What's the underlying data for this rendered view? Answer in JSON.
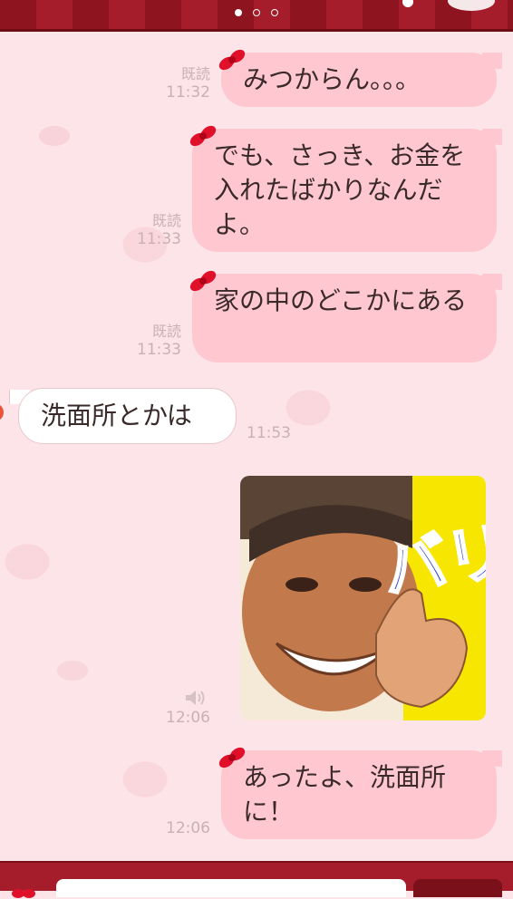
{
  "header": {
    "pages": [
      {
        "active": true
      },
      {
        "active": false
      },
      {
        "active": false
      }
    ]
  },
  "messages": [
    {
      "side": "right",
      "text": "みつからん。。。",
      "read": "既読",
      "time": "11:32"
    },
    {
      "side": "right",
      "text": "でも、さっき、お金を入れたばかりなんだよ。",
      "read": "既読",
      "time": "11:33"
    },
    {
      "side": "right",
      "text": "家の中のどこかにある",
      "read": "既読",
      "time": "11:33"
    },
    {
      "side": "left",
      "text": "洗面所とかは",
      "time": "11:53"
    },
    {
      "side": "right",
      "type": "sticker",
      "sticker_text": "バリよか!",
      "time": "12:06",
      "icon": "speaker-icon"
    },
    {
      "side": "right",
      "text": "あったよ、洗面所に！",
      "time": "12:06"
    }
  ],
  "colors": {
    "background": "#fde4e8",
    "bubble_right": "#ffc8d1",
    "bubble_left": "#ffffff",
    "bar": "#a51d2b",
    "meta_text": "#c8b0b4"
  },
  "footer": {
    "input_placeholder": ""
  }
}
